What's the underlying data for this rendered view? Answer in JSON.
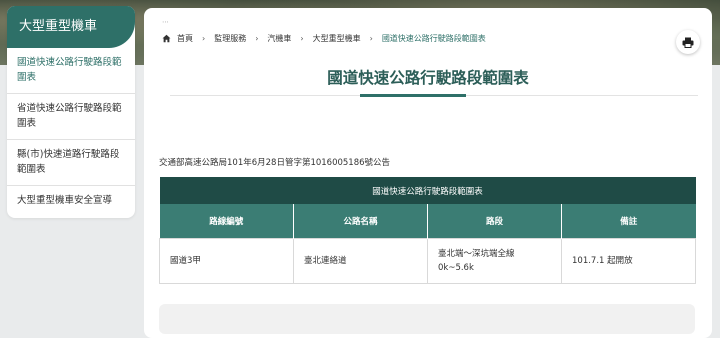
{
  "sidebar": {
    "title": "大型重型機車",
    "items": [
      {
        "label": "國道快速公路行駛路段範圍表"
      },
      {
        "label": "省道快速公路行駛路段範圍表"
      },
      {
        "label": "縣(市)快速道路行駛路段範圍表"
      },
      {
        "label": "大型重型機車安全宣導"
      }
    ]
  },
  "breadcrumb": {
    "home": "首頁",
    "items": [
      "監理服務",
      "汽機車",
      "大型重型機車",
      "國道快速公路行駛路段範圍表"
    ],
    "separator": "›"
  },
  "page": {
    "title": "國道快速公路行駛路段範圍表",
    "notice": "交通部高速公路局101年6月28日管字第1016005186號公告"
  },
  "table": {
    "caption": "國道快速公路行駛路段範圍表",
    "headers": [
      "路線編號",
      "公路名稱",
      "路段",
      "備註"
    ],
    "rows": [
      {
        "route": "國道3甲",
        "name": "臺北連絡道",
        "section_line1": "臺北端～深坑端全線",
        "section_line2": "0k~5.6k",
        "note": "101.7.1 起開放"
      }
    ]
  },
  "colors": {
    "accent": "#2e7068",
    "table_caption_bg": "#1f4b46",
    "table_header_bg": "#3b7d74"
  },
  "icons": {
    "home": "home-icon",
    "print": "print-icon",
    "more": "dots-icon"
  }
}
